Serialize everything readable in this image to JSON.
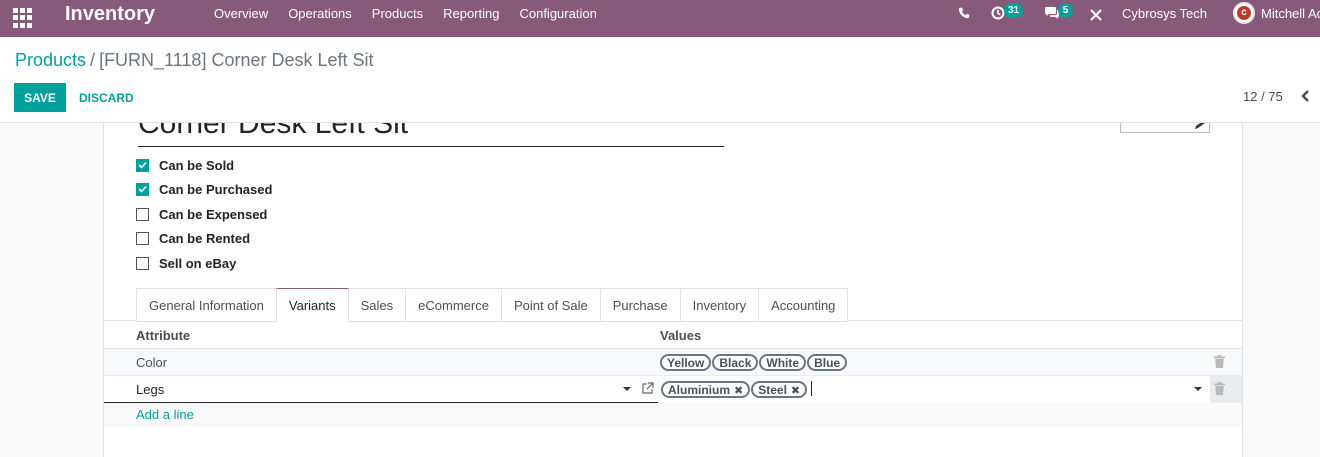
{
  "navbar": {
    "app_title": "Inventory",
    "menu": [
      "Overview",
      "Operations",
      "Products",
      "Reporting",
      "Configuration"
    ],
    "activity_count": "31",
    "message_count": "5",
    "company": "Cybrosys Tech",
    "user": "Mitchell Ac",
    "avatar_letter": "c",
    "icons": [
      "apps-grid-icon",
      "phone-icon",
      "activity-clock-icon",
      "chat-icon",
      "debug-icon"
    ]
  },
  "breadcrumb": {
    "parent": "Products",
    "separator": "/",
    "current": "[FURN_1118] Corner Desk Left Sit"
  },
  "buttons": {
    "save": "SAVE",
    "discard": "DISCARD"
  },
  "pager": {
    "value": "12 / 75"
  },
  "form": {
    "product_name": "Corner Desk Left Sit",
    "checkboxes": [
      {
        "label": "Can be Sold",
        "checked": true
      },
      {
        "label": "Can be Purchased",
        "checked": true
      },
      {
        "label": "Can be Expensed",
        "checked": false
      },
      {
        "label": "Can be Rented",
        "checked": false
      },
      {
        "label": "Sell on eBay",
        "checked": false
      }
    ],
    "tabs": [
      "General Information",
      "Variants",
      "Sales",
      "eCommerce",
      "Point of Sale",
      "Purchase",
      "Inventory",
      "Accounting"
    ],
    "active_tab": "Variants"
  },
  "variants": {
    "headers": {
      "attribute": "Attribute",
      "values": "Values"
    },
    "rows": [
      {
        "attribute": "Color",
        "values": [
          "Yellow",
          "Black",
          "White",
          "Blue"
        ]
      },
      {
        "attribute": "Legs",
        "values": [
          "Aluminium",
          "Steel"
        ]
      }
    ],
    "add_line": "Add a line"
  },
  "colors": {
    "navbar": "#875a7b",
    "accent": "#00a09d"
  }
}
